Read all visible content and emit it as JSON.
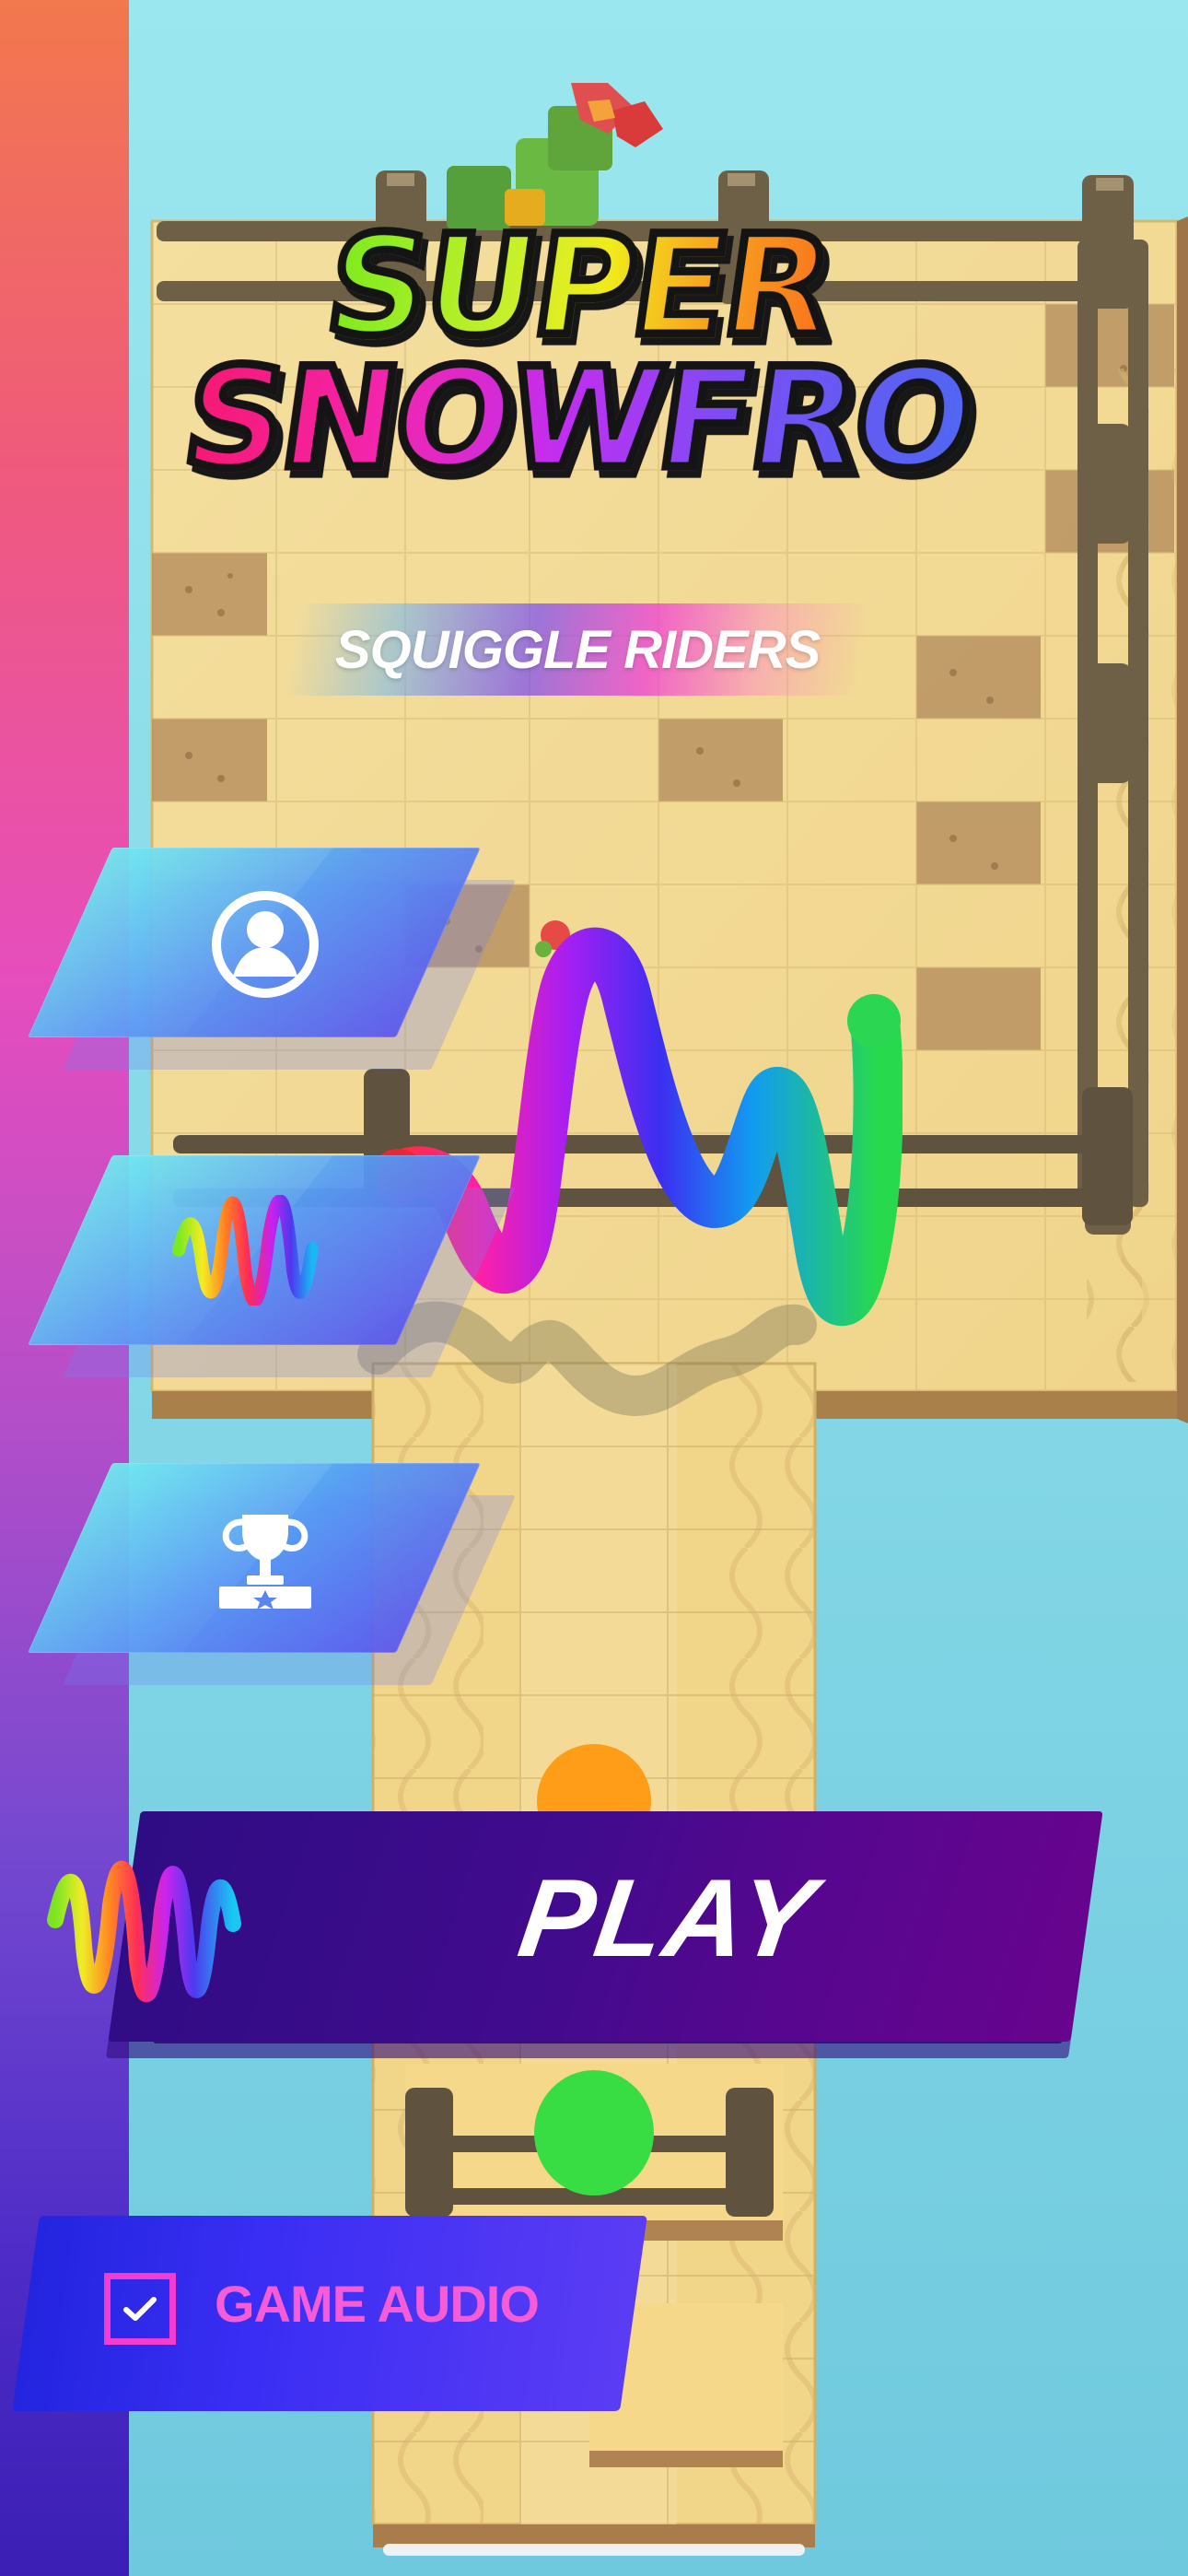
{
  "screen": {
    "title_line_1": "SUPER",
    "title_line_2": "SNOWFRO",
    "subtitle": "SQUIGGLE RIDERS"
  },
  "menu": {
    "profile_icon": "user-profile-icon",
    "squiggle_icon": "squiggle-character-icon",
    "leaderboard_icon": "trophy-podium-icon"
  },
  "actions": {
    "play_label": "PLAY",
    "game_audio_label": "GAME AUDIO",
    "game_audio_checked": true
  },
  "colors": {
    "stripe_top": "#f2784d",
    "stripe_bottom": "#3b1fb4",
    "menu_panel": "#5a86f0",
    "play_panel": "#410b8d",
    "audio_panel": "#3a2ef4",
    "audio_text": "#f65bd8"
  }
}
